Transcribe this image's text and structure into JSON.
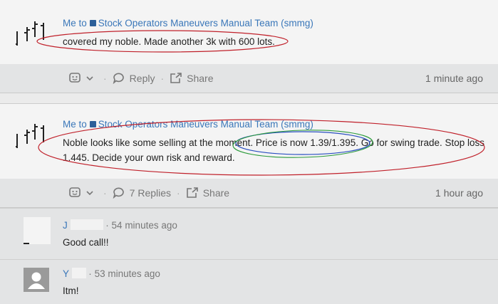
{
  "post1": {
    "author": "Me",
    "to_word": "to",
    "team": "Stock Operators Maneuvers Manual Team (smmg)",
    "text": "covered my noble. Made another 3k with 600 lots.",
    "reply_label": "Reply",
    "share_label": "Share",
    "time": "1 minute ago"
  },
  "post2": {
    "author": "Me",
    "to_word": "to",
    "team": "Stock Operators Maneuvers Manual Team (smmg)",
    "text_line1": "Noble looks like some selling at the moment. Price is now 1.39/1.395. Go for swing trade. Stop loss",
    "text_line2": "1.445. Decide your own risk and reward.",
    "replies_label": "7 Replies",
    "share_label": "Share",
    "time": "1 hour ago"
  },
  "replies": [
    {
      "name": "J",
      "time": "54 minutes ago",
      "text": "Good call!!"
    },
    {
      "name": "Y",
      "time": "53 minutes ago",
      "text": "Itm!"
    }
  ],
  "ui": {
    "dot": "·",
    "annotation_red": "#c0202a",
    "annotation_blue": "#2a4fc0",
    "annotation_green": "#2a9a3a",
    "link_color": "#3a77b9"
  }
}
